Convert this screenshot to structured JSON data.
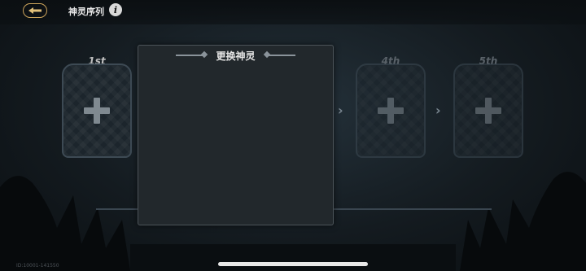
{
  "header": {
    "back_icon": "back-arrow-icon",
    "title": "神灵序列",
    "info_icon": "info-icon"
  },
  "slots": [
    {
      "label": "1st",
      "empty": true
    },
    {
      "label": "4th",
      "empty": true
    },
    {
      "label": "5th",
      "empty": true
    }
  ],
  "panel": {
    "title": "更换神灵"
  },
  "footer": {
    "build_id": "ID:10001-141550"
  },
  "colors": {
    "accent": "#c9a25a",
    "panel_bg": "#22282c"
  }
}
